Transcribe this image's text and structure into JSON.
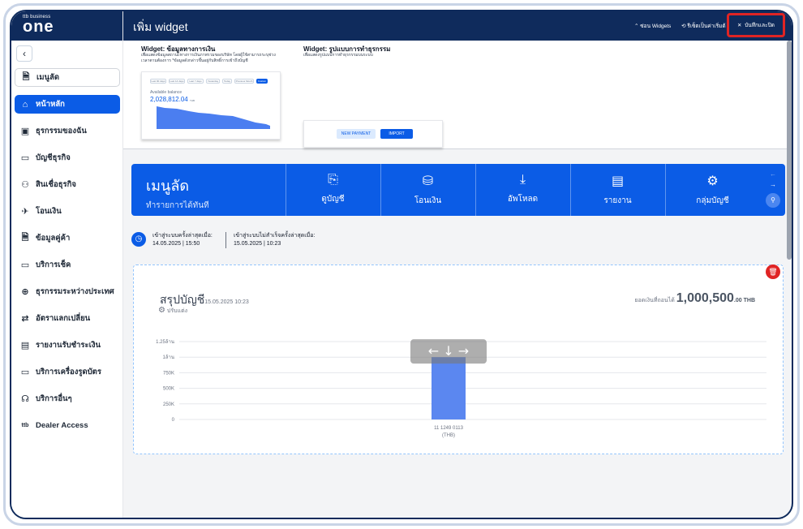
{
  "brand": {
    "small": "ttb business",
    "big": "one"
  },
  "sidebar": {
    "items": [
      {
        "icon": "menu-doc-icon",
        "label": "เมนูลัด"
      },
      {
        "icon": "home-icon",
        "label": "หน้าหลัก"
      },
      {
        "icon": "briefcase-icon",
        "label": "ธุรกรรมของฉัน"
      },
      {
        "icon": "wallet-icon",
        "label": "บัญชีธุรกิจ"
      },
      {
        "icon": "loan-icon",
        "label": "สินเชื่อธุรกิจ"
      },
      {
        "icon": "transfer-icon",
        "label": "โอนเงิน"
      },
      {
        "icon": "payee-icon",
        "label": "ข้อมูลคู่ค้า"
      },
      {
        "icon": "cheque-icon",
        "label": "บริการเช็ค"
      },
      {
        "icon": "globe-icon",
        "label": "ธุรกรรมระหว่างประเทศ"
      },
      {
        "icon": "exchange-icon",
        "label": "อัตราแลกเปลี่ยน"
      },
      {
        "icon": "report-icon",
        "label": "รายงานรับชำระเงิน"
      },
      {
        "icon": "card-icon",
        "label": "บริการเครื่องรูดบัตร"
      },
      {
        "icon": "headset-icon",
        "label": "บริการอื่นๆ"
      },
      {
        "icon": "ttb-logo-icon",
        "label": "Dealer Access"
      }
    ]
  },
  "header": {
    "title": "เพิ่ม widget",
    "hide_widgets": "ซ่อน Widgets",
    "reset": "รีเซ็ตเป็นค่าเริ่มต้",
    "save_close": "บันทึกและปิด"
  },
  "gallery": {
    "w1": {
      "title": "Widget: ข้อมูลทางการเงิน",
      "desc": "เพื่อแสดงข้อมูลสถานะทางการเงินภาพรวมของบริษัท โดยผู้ใช้สามารถระบุช่วงเวลาตามต้องการ *ข้อมูลดังกล่าวขึ้นอยู่กับสิทธิ์การเข้าถึงบัญชี",
      "chips": [
        "Last 90 days",
        "Last 14 days",
        "Last 7 days",
        "Yesterday",
        "Today",
        "Previous Month",
        "Custom"
      ],
      "balance_label": "Available balance",
      "balance_value": "2,028,812.04",
      "balance_currency": "THB"
    },
    "w2": {
      "title": "Widget: รูปแบบการทำธุรกรรม",
      "desc": "เพื่อแสดงรูปแบบการทำธุรกรรมบนระบบ",
      "btn1": "NEW PAYMENT",
      "btn2": "IMPORT"
    }
  },
  "banner": {
    "title": "เมนูลัด",
    "subtitle": "ทำรายการได้ทันที",
    "tiles": [
      {
        "icon": "account-icon",
        "label": "ดูบัญชี"
      },
      {
        "icon": "transfer-money-icon",
        "label": "โอนเงิน"
      },
      {
        "icon": "upload-icon",
        "label": "อัพโหลด"
      },
      {
        "icon": "report-doc-icon",
        "label": "รายงาน"
      },
      {
        "icon": "account-group-icon",
        "label": "กลุ่มบัญชี"
      }
    ]
  },
  "login": {
    "last_label": "เข้าสู่ระบบครั้งล่าสุดเมื่อ:",
    "last_value": "14.05.2025 | 15:50",
    "failed_label": "เข้าสู่ระบบไม่สำเร็จครั้งล่าสุดเมื่อ:",
    "failed_value": "15.05.2025 | 10:23"
  },
  "summary": {
    "title": "สรุปบัญชี",
    "date": "15.05.2025 10:23",
    "adjust": "ปรับแต่ง",
    "balance_label": "ยอดเงินที่ถอนได้",
    "balance_value": "1,000,500",
    "balance_decimals": ".00",
    "balance_currency": "THB"
  },
  "chart_data": {
    "type": "bar",
    "categories": [
      "11 1249 0113\n(THB)"
    ],
    "values": [
      1000500
    ],
    "ylim": [
      0,
      1250000
    ],
    "yticks": [
      "0",
      "250K",
      "500K",
      "750K",
      "1ล้าน",
      "1.25ล้าน"
    ],
    "grid": true,
    "colors": {
      "bar": "#5b87f0"
    }
  },
  "colors": {
    "navy": "#0f2b5c",
    "primary": "#0b5ce6",
    "danger": "#e02424"
  }
}
